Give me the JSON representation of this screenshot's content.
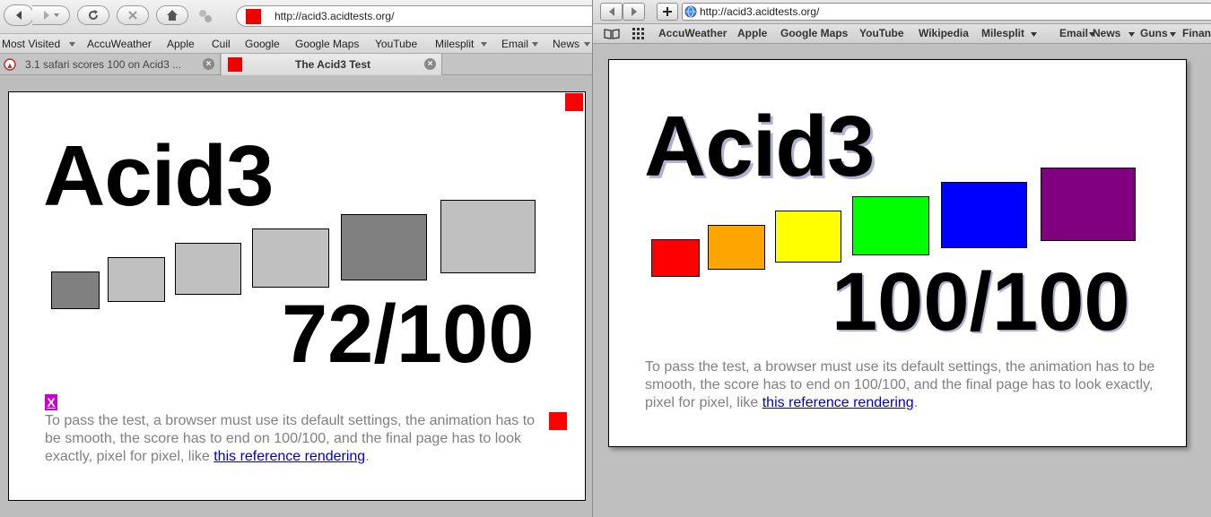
{
  "left_browser": {
    "address": "http://acid3.acidtests.org/",
    "bookmarks": [
      "Most Visited",
      "AccuWeather",
      "Apple",
      "Cuil",
      "Google",
      "Google Maps",
      "YouTube",
      "Milesplit",
      "Email",
      "News"
    ],
    "tabs": [
      {
        "label": "3.1 safari scores 100 on Acid3 ..."
      },
      {
        "label": "The Acid3 Test"
      }
    ],
    "page": {
      "title": "Acid3",
      "score": "72/100",
      "broken_marker": "X",
      "description": "To pass the test, a browser must use its default settings, the animation has to be smooth, the score has to end on 100/100, and the final page has to look exactly, pixel for pixel, like ",
      "link_text": "this reference rendering",
      "link_suffix": ".",
      "box_colors": [
        "#808080",
        "#c0c0c0",
        "#c0c0c0",
        "#c0c0c0",
        "#808080",
        "#c0c0c0"
      ],
      "marker_color": "#ff0000"
    }
  },
  "right_browser": {
    "address": "http://acid3.acidtests.org/",
    "bookmarks": [
      "AccuWeather",
      "Apple",
      "Google Maps",
      "YouTube",
      "Wikipedia",
      "Milesplit",
      "Email",
      "News",
      "Guns",
      "Finan"
    ],
    "page": {
      "title": "Acid3",
      "score": "100/100",
      "description": "To pass the test, a browser must use its default settings, the animation has to be smooth, the score has to end on 100/100, and the final page has to look exactly, pixel for pixel, like ",
      "link_text": "this reference rendering",
      "link_suffix": ".",
      "box_colors": [
        "#ff0000",
        "#ffa500",
        "#ffff00",
        "#00ff00",
        "#0000ff",
        "#800080"
      ]
    }
  },
  "icons": {
    "back": "back-arrow-icon",
    "forward": "forward-arrow-icon",
    "reload": "reload-icon",
    "stop": "stop-icon",
    "home": "home-icon",
    "add": "plus-icon",
    "bookmarks": "book-icon",
    "top_sites": "grid-icon",
    "globe": "globe-icon"
  }
}
